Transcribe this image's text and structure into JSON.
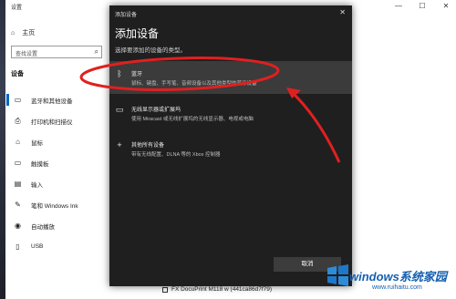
{
  "settings": {
    "window_title": "设置",
    "controls": [
      "—",
      "☐",
      "✕"
    ],
    "home_label": "主页",
    "search_placeholder": "查找设置",
    "section_title": "设备",
    "nav": [
      {
        "label": "蓝牙和其他设备",
        "icon": "bluetooth-devices-icon",
        "glyph": "▭"
      },
      {
        "label": "打印机和扫描仪",
        "icon": "printer-icon",
        "glyph": "⎙"
      },
      {
        "label": "鼠标",
        "icon": "mouse-icon",
        "glyph": "⌂"
      },
      {
        "label": "触摸板",
        "icon": "touchpad-icon",
        "glyph": "▭"
      },
      {
        "label": "输入",
        "icon": "keyboard-icon",
        "glyph": "▤"
      },
      {
        "label": "笔和 Windows Ink",
        "icon": "pen-icon",
        "glyph": "✎"
      },
      {
        "label": "自动播放",
        "icon": "autoplay-icon",
        "glyph": "◉"
      },
      {
        "label": "USB",
        "icon": "usb-icon",
        "glyph": "▯"
      }
    ],
    "printer_item": "FX DocuPrint M118 w (441ca86d7f79)"
  },
  "dialog": {
    "title": "添加设备",
    "close": "✕",
    "heading": "添加设备",
    "subtitle": "选择要添加的设备的类型。",
    "options": [
      {
        "title": "蓝牙",
        "desc": "鼠标、键盘、手写笔、音频设备以及其他类型的蓝牙设备",
        "icon": "bluetooth-icon",
        "glyph": "ᛒ"
      },
      {
        "title": "无线显示器或扩展坞",
        "desc": "使用 Miracast 或无线扩展坞的无线显示器、电视或电脑",
        "icon": "monitor-icon",
        "glyph": "▭"
      },
      {
        "title": "其他所有设备",
        "desc": "带有无线配置、DLNA 等的 Xbox 控制器",
        "icon": "plus-icon",
        "glyph": "+"
      }
    ],
    "cancel_label": "取消"
  },
  "watermark": {
    "brand": "windows系统家园",
    "url": "www.ruihaitu.com"
  },
  "colors": {
    "dialog_bg": "#1f1f1f",
    "selected_bg": "#3b3b3b",
    "annotation": "#e02020",
    "accent": "#0067c0"
  }
}
